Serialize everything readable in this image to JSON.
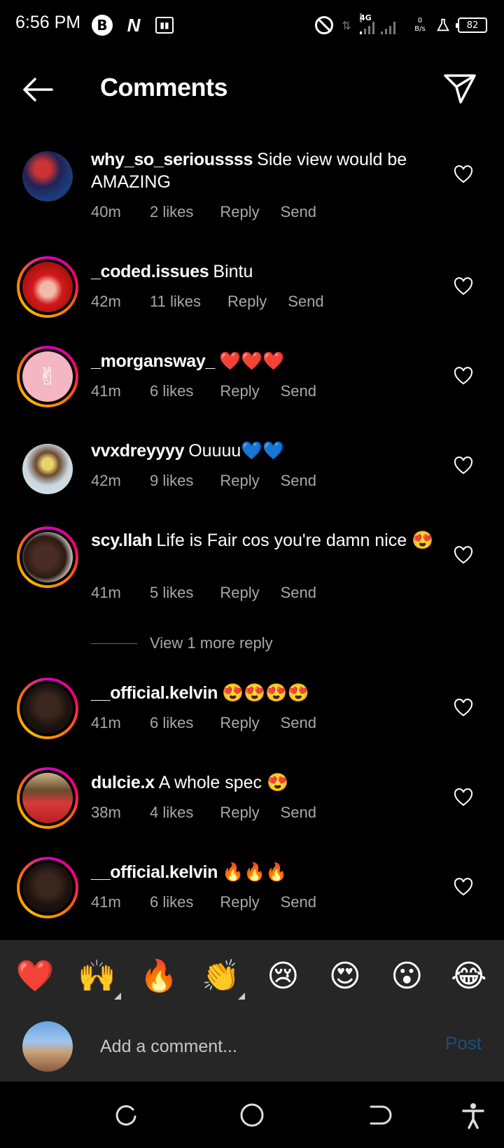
{
  "status_bar": {
    "time": "6:56 PM",
    "network": "4G",
    "speed_value": "0",
    "speed_unit": "B/s",
    "battery": "82"
  },
  "header": {
    "title": "Comments"
  },
  "comments": [
    {
      "username": "why_so_serioussss",
      "text": "Side view would be AMAZING",
      "time": "40m",
      "likes": "2 likes",
      "reply": "Reply",
      "send": "Send"
    },
    {
      "username": "_coded.issues",
      "text": "Bintu",
      "time": "42m",
      "likes": "11 likes",
      "reply": "Reply",
      "send": "Send"
    },
    {
      "username": "_morgansway_",
      "text": "❤️❤️❤️",
      "time": "41m",
      "likes": "6 likes",
      "reply": "Reply",
      "send": "Send"
    },
    {
      "username": "vvxdreyyyy",
      "text": "Ouuuu💙💙",
      "time": "42m",
      "likes": "9 likes",
      "reply": "Reply",
      "send": "Send"
    },
    {
      "username": "scy.llah",
      "text": "Life is Fair cos you're damn nice 😍",
      "time": "41m",
      "likes": "5 likes",
      "reply": "Reply",
      "send": "Send"
    },
    {
      "username": "__official.kelvin",
      "text": "😍😍😍😍",
      "time": "41m",
      "likes": "6 likes",
      "reply": "Reply",
      "send": "Send"
    },
    {
      "username": "dulcie.x",
      "text": "A whole spec 😍",
      "time": "38m",
      "likes": "4 likes",
      "reply": "Reply",
      "send": "Send"
    },
    {
      "username": "__official.kelvin",
      "text": "🔥🔥🔥",
      "time": "41m",
      "likes": "6 likes",
      "reply": "Reply",
      "send": "Send"
    }
  ],
  "view_more": "View 1 more reply",
  "emoji_bar": [
    "❤️",
    "🙌",
    "🔥",
    "👏",
    "😢",
    "😍",
    "😮",
    "😂"
  ],
  "comment_box": {
    "placeholder": "Add a comment...",
    "post_label": "Post"
  },
  "colors": {
    "background": "#000000",
    "secondary_text": "#a8a8a8",
    "post_button": "#1f4e79",
    "bottom_panel": "#262626"
  }
}
